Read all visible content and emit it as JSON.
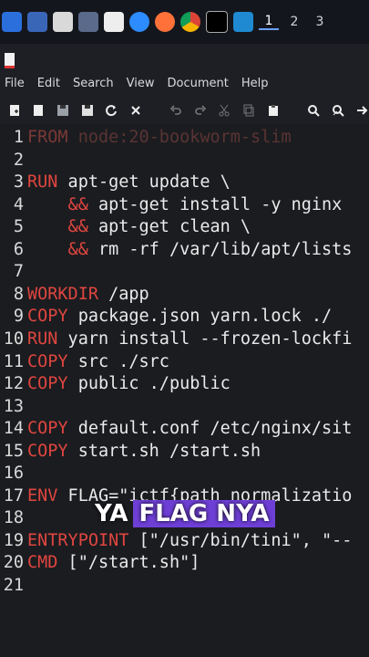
{
  "taskbar": {
    "workspaces": [
      "1",
      "2",
      "3"
    ]
  },
  "menu": [
    "File",
    "Edit",
    "Search",
    "View",
    "Document",
    "Help"
  ],
  "code_lines": [
    {
      "n": "1",
      "kw": "FROM",
      "rest": " node:20-bookworm-slim",
      "dim": true
    },
    {
      "n": "2",
      "kw": "",
      "rest": ""
    },
    {
      "n": "3",
      "kw": "RUN",
      "rest": " apt-get update \\"
    },
    {
      "n": "4",
      "kw": "",
      "pre": "    ",
      "amp": "&&",
      "rest": " apt-get install -y nginx"
    },
    {
      "n": "5",
      "kw": "",
      "pre": "    ",
      "amp": "&&",
      "rest": " apt-get clean \\"
    },
    {
      "n": "6",
      "kw": "",
      "pre": "    ",
      "amp": "&&",
      "rest": " rm -rf /var/lib/apt/lists"
    },
    {
      "n": "7",
      "kw": "",
      "rest": ""
    },
    {
      "n": "8",
      "kw": "WORKDIR",
      "rest": " /app"
    },
    {
      "n": "9",
      "kw": "COPY",
      "rest": " package.json yarn.lock ./"
    },
    {
      "n": "10",
      "kw": "RUN",
      "rest": " yarn install --frozen-lockfi"
    },
    {
      "n": "11",
      "kw": "COPY",
      "rest": " src ./src"
    },
    {
      "n": "12",
      "kw": "COPY",
      "rest": " public ./public"
    },
    {
      "n": "13",
      "kw": "",
      "rest": ""
    },
    {
      "n": "14",
      "kw": "COPY",
      "rest": " default.conf /etc/nginx/sit"
    },
    {
      "n": "15",
      "kw": "COPY",
      "rest": " start.sh /start.sh"
    },
    {
      "n": "16",
      "kw": "",
      "rest": ""
    },
    {
      "n": "17",
      "kw": "ENV",
      "rest": " FLAG=\"ictf{path_normalizatio"
    },
    {
      "n": "18",
      "kw": "",
      "rest": ""
    },
    {
      "n": "19",
      "kw": "ENTRYPOINT",
      "rest": " [\"/usr/bin/tini\", \"--"
    },
    {
      "n": "20",
      "kw": "CMD",
      "rest": " [\"/start.sh\"]"
    },
    {
      "n": "21",
      "kw": "",
      "rest": ""
    }
  ],
  "caption": {
    "plain": "YA",
    "highlight": "FLAG NYA"
  },
  "colors": {
    "keyword": "#e0463f",
    "caption_bg": "#6e3fd6"
  }
}
